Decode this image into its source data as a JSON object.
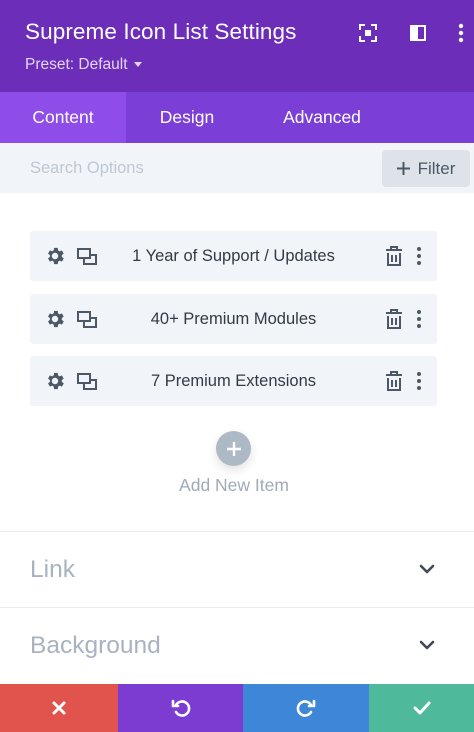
{
  "header": {
    "title": "Supreme Icon List Settings",
    "preset_label": "Preset: Default",
    "icons": [
      "fullscreen-icon",
      "sidebar-toggle-icon",
      "more-icon"
    ]
  },
  "tabs": [
    {
      "label": "Content",
      "active": true
    },
    {
      "label": "Design",
      "active": false
    },
    {
      "label": "Advanced",
      "active": false
    }
  ],
  "search": {
    "placeholder": "Search Options",
    "value": ""
  },
  "filter": {
    "label": "Filter",
    "icon": "plus-icon"
  },
  "items": [
    {
      "label": "1 Year of Support / Updates"
    },
    {
      "label": "40+ Premium Modules"
    },
    {
      "label": "7 Premium Extensions"
    }
  ],
  "add_item": {
    "label": "Add New Item",
    "icon": "plus-icon"
  },
  "sections": [
    {
      "title": "Link"
    },
    {
      "title": "Background"
    }
  ],
  "footer": {
    "buttons": [
      {
        "name": "discard",
        "icon": "close-icon",
        "color": "#e0544d"
      },
      {
        "name": "undo",
        "icon": "undo-icon",
        "color": "#7c3bd1"
      },
      {
        "name": "redo",
        "icon": "redo-icon",
        "color": "#3e86d8"
      },
      {
        "name": "save",
        "icon": "check-icon",
        "color": "#4eb99b"
      }
    ]
  },
  "colors": {
    "header_bg": "#6c2eb9",
    "tabs_bg": "#7b3ed6",
    "active_tab_bg": "#8e4ce8"
  }
}
